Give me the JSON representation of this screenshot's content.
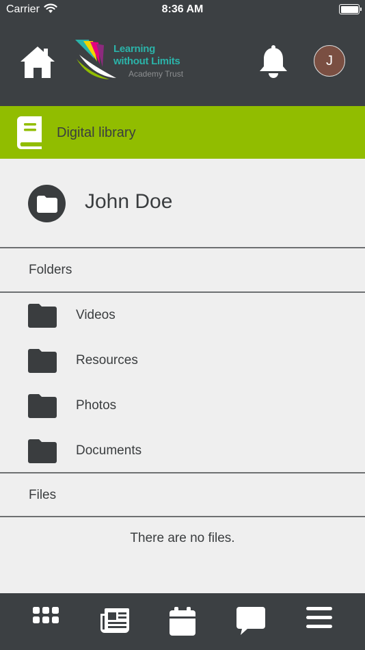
{
  "status_bar": {
    "carrier": "Carrier",
    "time": "8:36 AM"
  },
  "header": {
    "logo": {
      "line1": "Learning",
      "line2": "without Limits",
      "line3": "Academy Trust"
    },
    "avatar_initial": "J"
  },
  "section_bar": {
    "title": "Digital library",
    "color": "#91bd00"
  },
  "owner": {
    "name": "John Doe"
  },
  "folders": {
    "heading": "Folders",
    "items": [
      {
        "label": "Videos"
      },
      {
        "label": "Resources"
      },
      {
        "label": "Photos"
      },
      {
        "label": "Documents"
      }
    ]
  },
  "files": {
    "heading": "Files",
    "empty_message": "There are no files."
  },
  "tab_bar": {
    "items": [
      {
        "icon": "grid-icon"
      },
      {
        "icon": "newspaper-icon"
      },
      {
        "icon": "calendar-icon"
      },
      {
        "icon": "chat-bubble-icon"
      },
      {
        "icon": "menu-icon"
      }
    ]
  },
  "colors": {
    "dark": "#3c4043",
    "accent": "#91bd00",
    "background": "#efefef",
    "logo_teal": "#2bb3a9"
  }
}
